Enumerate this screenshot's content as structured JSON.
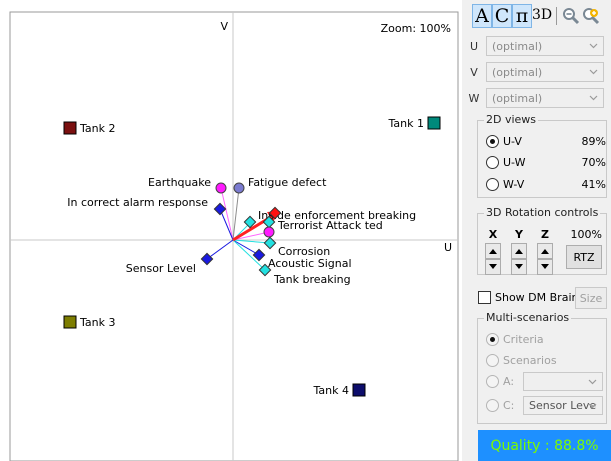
{
  "plot": {
    "zoom_label": "Zoom: 100%",
    "axis_v": "V",
    "axis_u": "U"
  },
  "tanks": [
    {
      "label": "Tank 1",
      "color": "#00897b"
    },
    {
      "label": "Tank 2",
      "color": "#7b1010"
    },
    {
      "label": "Tank 3",
      "color": "#7d7d00"
    },
    {
      "label": "Tank 4",
      "color": "#0d0d6b"
    }
  ],
  "points": [
    {
      "label": "Earthquake",
      "color": "#ff1aff",
      "shape": "circle"
    },
    {
      "label": "Fatigue defect",
      "color": "#7b7bd0",
      "shape": "circle"
    },
    {
      "label": "In correct alarm response",
      "color": "#1a1ae0",
      "shape": "diamond"
    },
    {
      "label": "Inside enforcement breaking",
      "color": "#ff1010",
      "shape": "diamond"
    },
    {
      "label": "Terrorist Attack ted",
      "color": "#ff1aff",
      "shape": "circle"
    },
    {
      "label": "Corrosion",
      "color": "#22e0e0",
      "shape": "diamond"
    },
    {
      "label": "Acoustic Signal",
      "color": "#1a1ae0",
      "shape": "diamond"
    },
    {
      "label": "Tank breaking",
      "color": "#22e0e0",
      "shape": "diamond"
    },
    {
      "label": "Sensor Level",
      "color": "#1a1ae0",
      "shape": "diamond"
    }
  ],
  "toolbar": {
    "a_label": "A",
    "c_label": "C",
    "pi_label": "π",
    "threed_label": "3D"
  },
  "axes_select": {
    "u_label": "U",
    "u_value": "(optimal)",
    "v_label": "V",
    "v_value": "(optimal)",
    "w_label": "W",
    "w_value": "(optimal)"
  },
  "views2d": {
    "title": "2D views",
    "items": [
      {
        "label": "U-V",
        "pct": "89%"
      },
      {
        "label": "U-W",
        "pct": "70%"
      },
      {
        "label": "W-V",
        "pct": "41%"
      }
    ]
  },
  "rotation": {
    "title": "3D Rotation controls",
    "x": "X",
    "y": "Y",
    "z": "Z",
    "pct": "100%",
    "rtz_label": "RTZ"
  },
  "dm_brain": {
    "show_label": "Show DM Brain",
    "size_label": "Size"
  },
  "multi": {
    "title": "Multi-scenarios",
    "criteria": "Criteria",
    "scenarios": "Scenarios",
    "a_label": "A:",
    "a_value": "",
    "c_label": "C:",
    "c_value": "Sensor Leve"
  },
  "quality": "Quality : 88.8%",
  "colors": {
    "vector": "#ff2020",
    "quality_bg": "#1e90ff",
    "quality_text": "#7CFC00"
  }
}
